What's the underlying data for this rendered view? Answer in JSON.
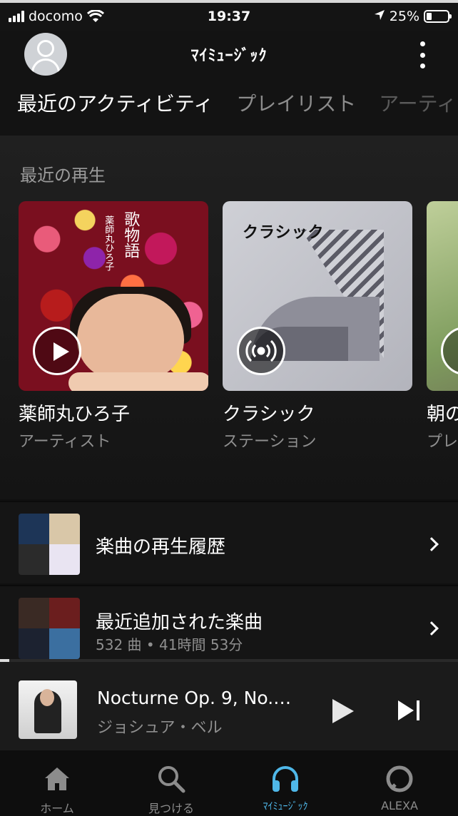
{
  "status_bar": {
    "carrier": "docomo",
    "time": "19:37",
    "battery": "25%"
  },
  "header": {
    "title": "ﾏｲﾐｭｰｼﾞｯｸ",
    "tabs": [
      "最近のアクティビティ",
      "プレイリスト",
      "アーティ"
    ]
  },
  "recent": {
    "title": "最近の再生",
    "cards": [
      {
        "title": "薬師丸ひろ子",
        "subtitle": "アーティスト",
        "art_text": "歌物語",
        "art_subtext": "薬師丸ひろ子"
      },
      {
        "title": "クラシック",
        "subtitle": "ステーション",
        "art_text": "クラシック"
      },
      {
        "title": "朝の",
        "subtitle": "プレ"
      }
    ]
  },
  "rows": [
    {
      "title": "楽曲の再生履歴"
    },
    {
      "title": "最近追加された楽曲",
      "subtitle": "532 曲 • 41時間 53分"
    }
  ],
  "now_playing": {
    "title": "Nocturne Op. 9, No.…",
    "artist": "ジョシュア・ベル",
    "progress": 0.02
  },
  "nav": [
    {
      "label": "ホーム",
      "icon": "home-icon"
    },
    {
      "label": "見つける",
      "icon": "search-icon"
    },
    {
      "label": "ﾏｲﾐｭｰｼﾞｯｸ",
      "icon": "headphones-icon"
    },
    {
      "label": "ALEXA",
      "icon": "alexa-icon"
    }
  ],
  "colors": {
    "accent": "#4fb7e8",
    "background": "#101010",
    "secondary_text": "#8f8f8f"
  }
}
